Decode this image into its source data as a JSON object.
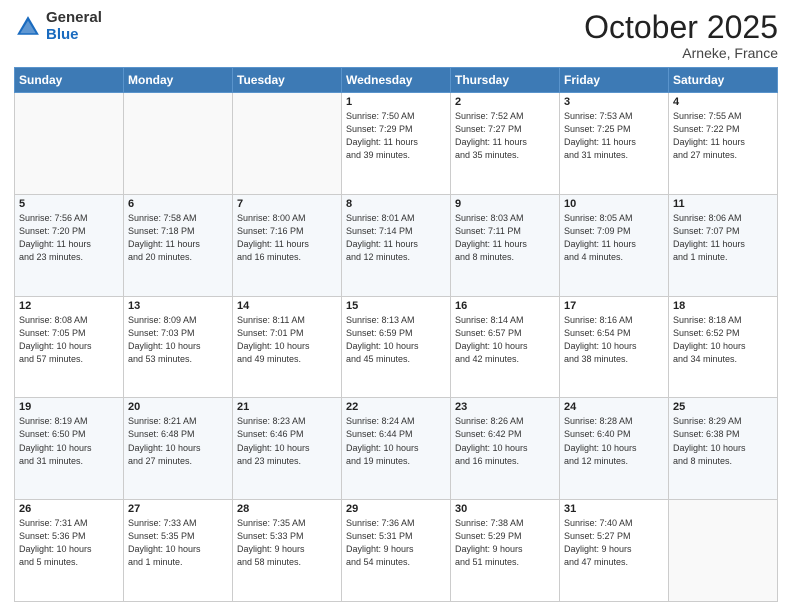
{
  "header": {
    "logo_general": "General",
    "logo_blue": "Blue",
    "month_title": "October 2025",
    "location": "Arneke, France"
  },
  "days_of_week": [
    "Sunday",
    "Monday",
    "Tuesday",
    "Wednesday",
    "Thursday",
    "Friday",
    "Saturday"
  ],
  "weeks": [
    [
      {
        "day": "",
        "info": ""
      },
      {
        "day": "",
        "info": ""
      },
      {
        "day": "",
        "info": ""
      },
      {
        "day": "1",
        "info": "Sunrise: 7:50 AM\nSunset: 7:29 PM\nDaylight: 11 hours\nand 39 minutes."
      },
      {
        "day": "2",
        "info": "Sunrise: 7:52 AM\nSunset: 7:27 PM\nDaylight: 11 hours\nand 35 minutes."
      },
      {
        "day": "3",
        "info": "Sunrise: 7:53 AM\nSunset: 7:25 PM\nDaylight: 11 hours\nand 31 minutes."
      },
      {
        "day": "4",
        "info": "Sunrise: 7:55 AM\nSunset: 7:22 PM\nDaylight: 11 hours\nand 27 minutes."
      }
    ],
    [
      {
        "day": "5",
        "info": "Sunrise: 7:56 AM\nSunset: 7:20 PM\nDaylight: 11 hours\nand 23 minutes."
      },
      {
        "day": "6",
        "info": "Sunrise: 7:58 AM\nSunset: 7:18 PM\nDaylight: 11 hours\nand 20 minutes."
      },
      {
        "day": "7",
        "info": "Sunrise: 8:00 AM\nSunset: 7:16 PM\nDaylight: 11 hours\nand 16 minutes."
      },
      {
        "day": "8",
        "info": "Sunrise: 8:01 AM\nSunset: 7:14 PM\nDaylight: 11 hours\nand 12 minutes."
      },
      {
        "day": "9",
        "info": "Sunrise: 8:03 AM\nSunset: 7:11 PM\nDaylight: 11 hours\nand 8 minutes."
      },
      {
        "day": "10",
        "info": "Sunrise: 8:05 AM\nSunset: 7:09 PM\nDaylight: 11 hours\nand 4 minutes."
      },
      {
        "day": "11",
        "info": "Sunrise: 8:06 AM\nSunset: 7:07 PM\nDaylight: 11 hours\nand 1 minute."
      }
    ],
    [
      {
        "day": "12",
        "info": "Sunrise: 8:08 AM\nSunset: 7:05 PM\nDaylight: 10 hours\nand 57 minutes."
      },
      {
        "day": "13",
        "info": "Sunrise: 8:09 AM\nSunset: 7:03 PM\nDaylight: 10 hours\nand 53 minutes."
      },
      {
        "day": "14",
        "info": "Sunrise: 8:11 AM\nSunset: 7:01 PM\nDaylight: 10 hours\nand 49 minutes."
      },
      {
        "day": "15",
        "info": "Sunrise: 8:13 AM\nSunset: 6:59 PM\nDaylight: 10 hours\nand 45 minutes."
      },
      {
        "day": "16",
        "info": "Sunrise: 8:14 AM\nSunset: 6:57 PM\nDaylight: 10 hours\nand 42 minutes."
      },
      {
        "day": "17",
        "info": "Sunrise: 8:16 AM\nSunset: 6:54 PM\nDaylight: 10 hours\nand 38 minutes."
      },
      {
        "day": "18",
        "info": "Sunrise: 8:18 AM\nSunset: 6:52 PM\nDaylight: 10 hours\nand 34 minutes."
      }
    ],
    [
      {
        "day": "19",
        "info": "Sunrise: 8:19 AM\nSunset: 6:50 PM\nDaylight: 10 hours\nand 31 minutes."
      },
      {
        "day": "20",
        "info": "Sunrise: 8:21 AM\nSunset: 6:48 PM\nDaylight: 10 hours\nand 27 minutes."
      },
      {
        "day": "21",
        "info": "Sunrise: 8:23 AM\nSunset: 6:46 PM\nDaylight: 10 hours\nand 23 minutes."
      },
      {
        "day": "22",
        "info": "Sunrise: 8:24 AM\nSunset: 6:44 PM\nDaylight: 10 hours\nand 19 minutes."
      },
      {
        "day": "23",
        "info": "Sunrise: 8:26 AM\nSunset: 6:42 PM\nDaylight: 10 hours\nand 16 minutes."
      },
      {
        "day": "24",
        "info": "Sunrise: 8:28 AM\nSunset: 6:40 PM\nDaylight: 10 hours\nand 12 minutes."
      },
      {
        "day": "25",
        "info": "Sunrise: 8:29 AM\nSunset: 6:38 PM\nDaylight: 10 hours\nand 8 minutes."
      }
    ],
    [
      {
        "day": "26",
        "info": "Sunrise: 7:31 AM\nSunset: 5:36 PM\nDaylight: 10 hours\nand 5 minutes."
      },
      {
        "day": "27",
        "info": "Sunrise: 7:33 AM\nSunset: 5:35 PM\nDaylight: 10 hours\nand 1 minute."
      },
      {
        "day": "28",
        "info": "Sunrise: 7:35 AM\nSunset: 5:33 PM\nDaylight: 9 hours\nand 58 minutes."
      },
      {
        "day": "29",
        "info": "Sunrise: 7:36 AM\nSunset: 5:31 PM\nDaylight: 9 hours\nand 54 minutes."
      },
      {
        "day": "30",
        "info": "Sunrise: 7:38 AM\nSunset: 5:29 PM\nDaylight: 9 hours\nand 51 minutes."
      },
      {
        "day": "31",
        "info": "Sunrise: 7:40 AM\nSunset: 5:27 PM\nDaylight: 9 hours\nand 47 minutes."
      },
      {
        "day": "",
        "info": ""
      }
    ]
  ]
}
